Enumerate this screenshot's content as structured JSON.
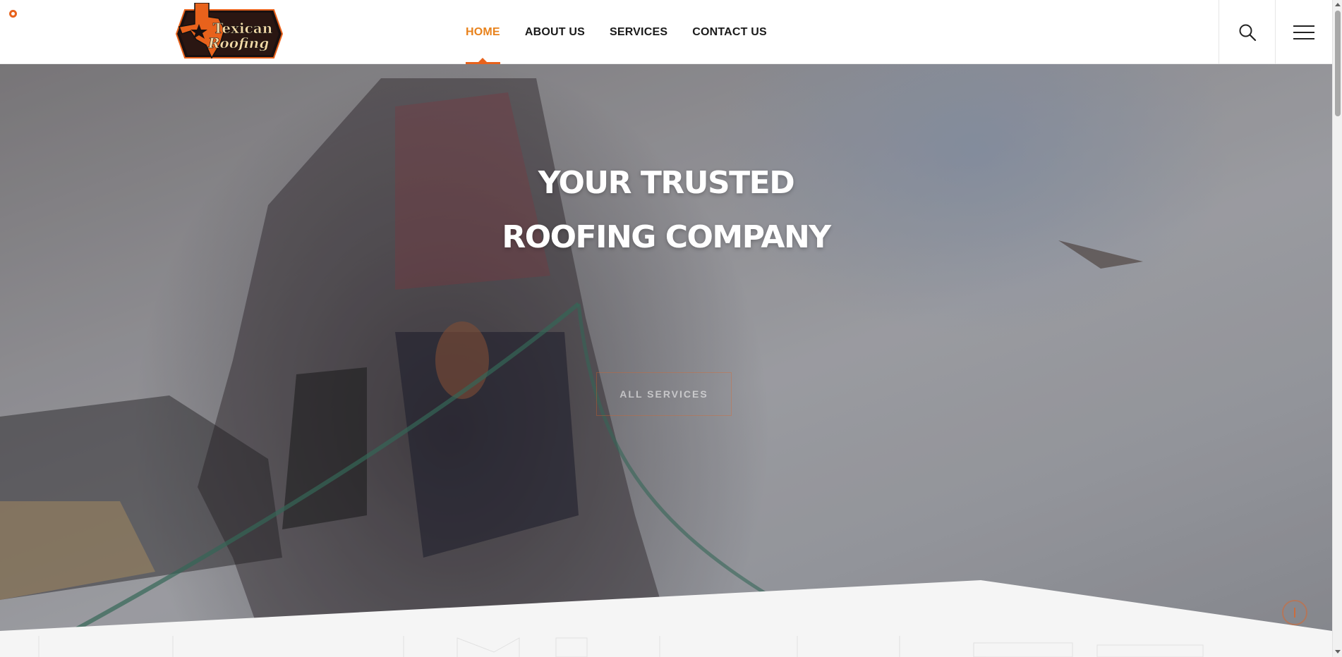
{
  "brand": {
    "logo_line1": "Texican",
    "logo_line2": "Roofing",
    "accent_color": "#e8621c",
    "active_color": "#e8821c"
  },
  "nav": {
    "items": [
      {
        "label": "HOME",
        "active": true
      },
      {
        "label": "ABOUT US",
        "active": false
      },
      {
        "label": "SERVICES",
        "active": false
      },
      {
        "label": "CONTACT US",
        "active": false
      }
    ]
  },
  "header": {
    "search_icon": "search-icon",
    "menu_icon": "hamburger-menu-icon"
  },
  "hero": {
    "title_line1": "YOUR TRUSTED",
    "title_line2": "ROOFING COMPANY",
    "button_label": "ALL SERVICES"
  },
  "utility": {
    "scroll_top_icon": "scroll-to-top-icon"
  }
}
